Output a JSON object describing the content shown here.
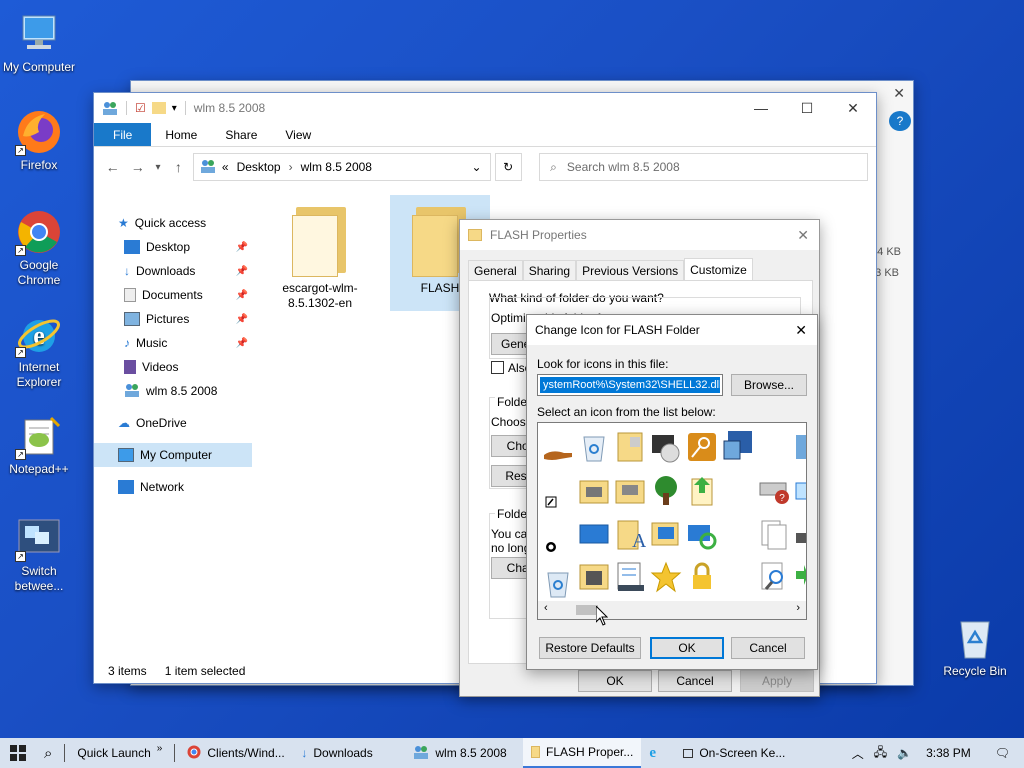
{
  "desktop": {
    "icons": [
      {
        "label": "My Computer",
        "icon": "computer-icon"
      },
      {
        "label": "Firefox",
        "icon": "firefox-icon"
      },
      {
        "label": "Google Chrome",
        "icon": "chrome-icon"
      },
      {
        "label": "Internet Explorer",
        "icon": "ie-icon"
      },
      {
        "label": "Notepad++",
        "icon": "notepadpp-icon"
      },
      {
        "label": "Switch betwee...",
        "icon": "switch-windows-icon"
      },
      {
        "label": "Recycle Bin",
        "icon": "recycle-bin-icon"
      }
    ]
  },
  "bg_window": {
    "sizes": [
      "4 KB",
      "3 KB"
    ]
  },
  "explorer": {
    "title": "wlm 8.5 2008",
    "ribbon_tabs": [
      "File",
      "Home",
      "Share",
      "View"
    ],
    "breadcrumb": [
      "Desktop",
      "wlm 8.5 2008"
    ],
    "breadcrumb_prefix": "«",
    "search_placeholder": "Search wlm 8.5 2008",
    "nav": {
      "quick_access": "Quick access",
      "items": [
        "Desktop",
        "Downloads",
        "Documents",
        "Pictures",
        "Music",
        "Videos",
        "wlm 8.5 2008"
      ],
      "onedrive": "OneDrive",
      "my_computer": "My Computer",
      "network": "Network"
    },
    "files": [
      {
        "name": "escargot-wlm-8.5.1302-en"
      },
      {
        "name": "FLASH"
      }
    ],
    "status": {
      "count": "3 items",
      "selected": "1 item selected"
    }
  },
  "properties": {
    "title": "FLASH Properties",
    "tabs": [
      "General",
      "Sharing",
      "Previous Versions",
      "Customize"
    ],
    "question": "What kind of folder do you want?",
    "optimize_label": "Optimize this folder for:",
    "general_fragment": "Genera",
    "also_fragment": "Also",
    "folder_p_fragment": "Folder p",
    "choose_fragment": "Choose",
    "choo_btn": "Choo",
    "resto_btn": "Resto",
    "folder_ic_fragment": "Folder ic",
    "you_can_fragment": "You can",
    "no_longer_fragment": "no longe",
    "chan_btn": "Chan",
    "ok": "OK",
    "cancel": "Cancel",
    "apply": "Apply"
  },
  "change_icon": {
    "title": "Change Icon for FLASH Folder",
    "look_label": "Look for icons in this file:",
    "file_value": "ystemRoot%\\System32\\SHELL32.dll",
    "browse": "Browse...",
    "select_label": "Select an icon from the list below:",
    "restore": "Restore Defaults",
    "ok": "OK",
    "cancel": "Cancel"
  },
  "taskbar": {
    "quick_launch": "Quick Launch",
    "items": [
      {
        "label": "Clients/Wind...",
        "icon": "chrome-icon"
      },
      {
        "label": "Downloads",
        "icon": "downloads-icon"
      },
      {
        "label": "wlm 8.5 2008",
        "icon": "users-folder-icon"
      },
      {
        "label": "FLASH Proper...",
        "icon": "folder-icon"
      },
      {
        "label": "",
        "icon": "ie-icon"
      },
      {
        "label": "On-Screen Ke...",
        "icon": "keyboard-icon"
      }
    ],
    "time": "3:38 PM"
  },
  "colors": {
    "accent": "#1979ca",
    "selection": "#cce4f7",
    "desktop": "#1a4fc4"
  }
}
